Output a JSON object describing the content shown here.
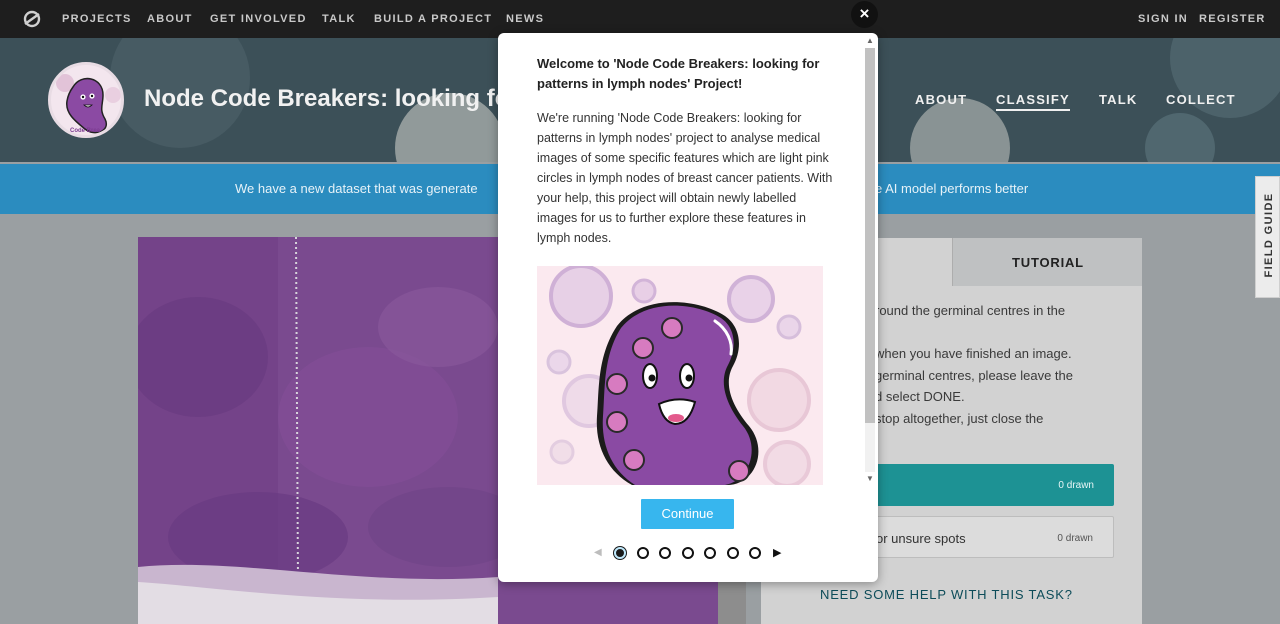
{
  "topnav": {
    "items": [
      "PROJECTS",
      "ABOUT",
      "GET INVOLVED",
      "TALK",
      "BUILD A PROJECT",
      "NEWS"
    ],
    "sign_in": "SIGN IN",
    "register": "REGISTER"
  },
  "project": {
    "title": "Node Code Breakers: looking for patterns in lymph nodes",
    "avatar_text": "Code Brea",
    "nav": [
      "ABOUT",
      "CLASSIFY",
      "TALK",
      "COLLECT"
    ],
    "active_nav": "CLASSIFY"
  },
  "announcement": {
    "left": "We have a new dataset that was generate",
    "right": "e AI model performs better"
  },
  "field_guide": "FIELD GUIDE",
  "task": {
    "tutorial_tab": "TUTORIAL",
    "instructions": [
      "round the germinal centres in the",
      "when you have finished an image.",
      "germinal centres, please leave the",
      "d select DONE.",
      "stop altogether, just close the"
    ],
    "tools": [
      {
        "label": "",
        "count": "0 drawn",
        "color": "#1d9294"
      },
      {
        "label": "or unsure spots",
        "count": "0 drawn",
        "color": "#dcdcdc"
      }
    ],
    "help": "NEED SOME HELP WITH THIS TASK?"
  },
  "modal": {
    "close": "×",
    "title": "Welcome to 'Node Code Breakers: looking for patterns in lymph nodes' Project!",
    "body": "We're running 'Node Code Breakers: looking for patterns in lymph nodes' project to analyse medical images of some specific features which are light pink circles in lymph nodes of breast cancer patients. With your help, this project will obtain newly labelled images for us to further explore these features in lymph nodes.",
    "continue": "Continue",
    "pages": 7,
    "current_page": 1
  }
}
